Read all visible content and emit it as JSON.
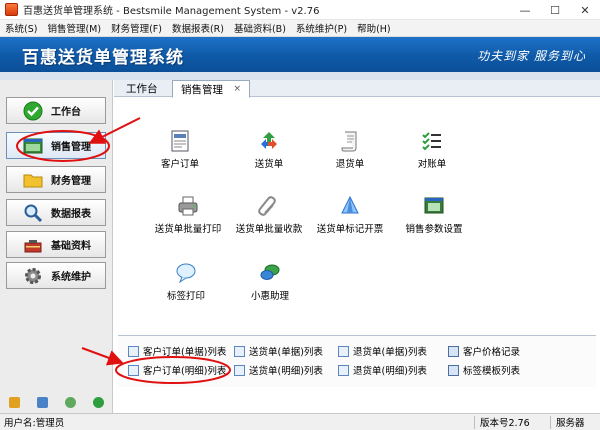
{
  "window": {
    "title": "百惠送货单管理系统 - Bestsmile Management System - v2.76",
    "minimize": "—",
    "maximize": "☐",
    "close": "✕"
  },
  "menu": [
    {
      "label": "系统(S)"
    },
    {
      "label": "销售管理(M)"
    },
    {
      "label": "财务管理(F)"
    },
    {
      "label": "数据报表(R)"
    },
    {
      "label": "基础资料(B)"
    },
    {
      "label": "系统维护(P)"
    },
    {
      "label": "帮助(H)"
    }
  ],
  "banner": {
    "title": "百惠送货单管理系统",
    "slogan": "功夫到家 服务到心"
  },
  "sidebar": {
    "items": [
      {
        "label": "工作台",
        "icon": "check-circle-icon"
      },
      {
        "label": "销售管理",
        "icon": "sales-window-icon"
      },
      {
        "label": "财务管理",
        "icon": "folder-icon"
      },
      {
        "label": "数据报表",
        "icon": "magnifier-icon"
      },
      {
        "label": "基础资料",
        "icon": "tools-icon"
      },
      {
        "label": "系统维护",
        "icon": "gear-icon"
      }
    ],
    "active_index": 1
  },
  "tabs": [
    {
      "label": "工作台"
    },
    {
      "label": "销售管理",
      "close": "×"
    }
  ],
  "modules": [
    {
      "label": "客户订单",
      "icon": "document-icon"
    },
    {
      "label": "送货单",
      "icon": "recycle-icon"
    },
    {
      "label": "退货单",
      "icon": "scroll-icon"
    },
    {
      "label": "对账单",
      "icon": "checklist-icon"
    },
    {
      "label": "送货单批量打印",
      "icon": "printer-icon"
    },
    {
      "label": "送货单批量收款",
      "icon": "paperclip-icon"
    },
    {
      "label": "送货单标记开票",
      "icon": "cone-icon"
    },
    {
      "label": "销售参数设置",
      "icon": "window-settings-icon"
    },
    {
      "label": "标签打印",
      "icon": "speech-bubble-icon"
    },
    {
      "label": "小惠助理",
      "icon": "chat-bubbles-icon"
    }
  ],
  "lists": [
    {
      "label": "客户订单(单据)列表"
    },
    {
      "label": "送货单(单据)列表"
    },
    {
      "label": "退货单(单据)列表"
    },
    {
      "label": "客户价格记录"
    },
    {
      "label": "客户订单(明细)列表"
    },
    {
      "label": "送货单(明细)列表"
    },
    {
      "label": "退货单(明细)列表"
    },
    {
      "label": "标签模板列表"
    }
  ],
  "status": {
    "user": "用户名:管理员",
    "version": "版本号2.76",
    "service": "服务器"
  },
  "colors": {
    "banner": "#1565c0",
    "annotation_red": "#e01010"
  }
}
